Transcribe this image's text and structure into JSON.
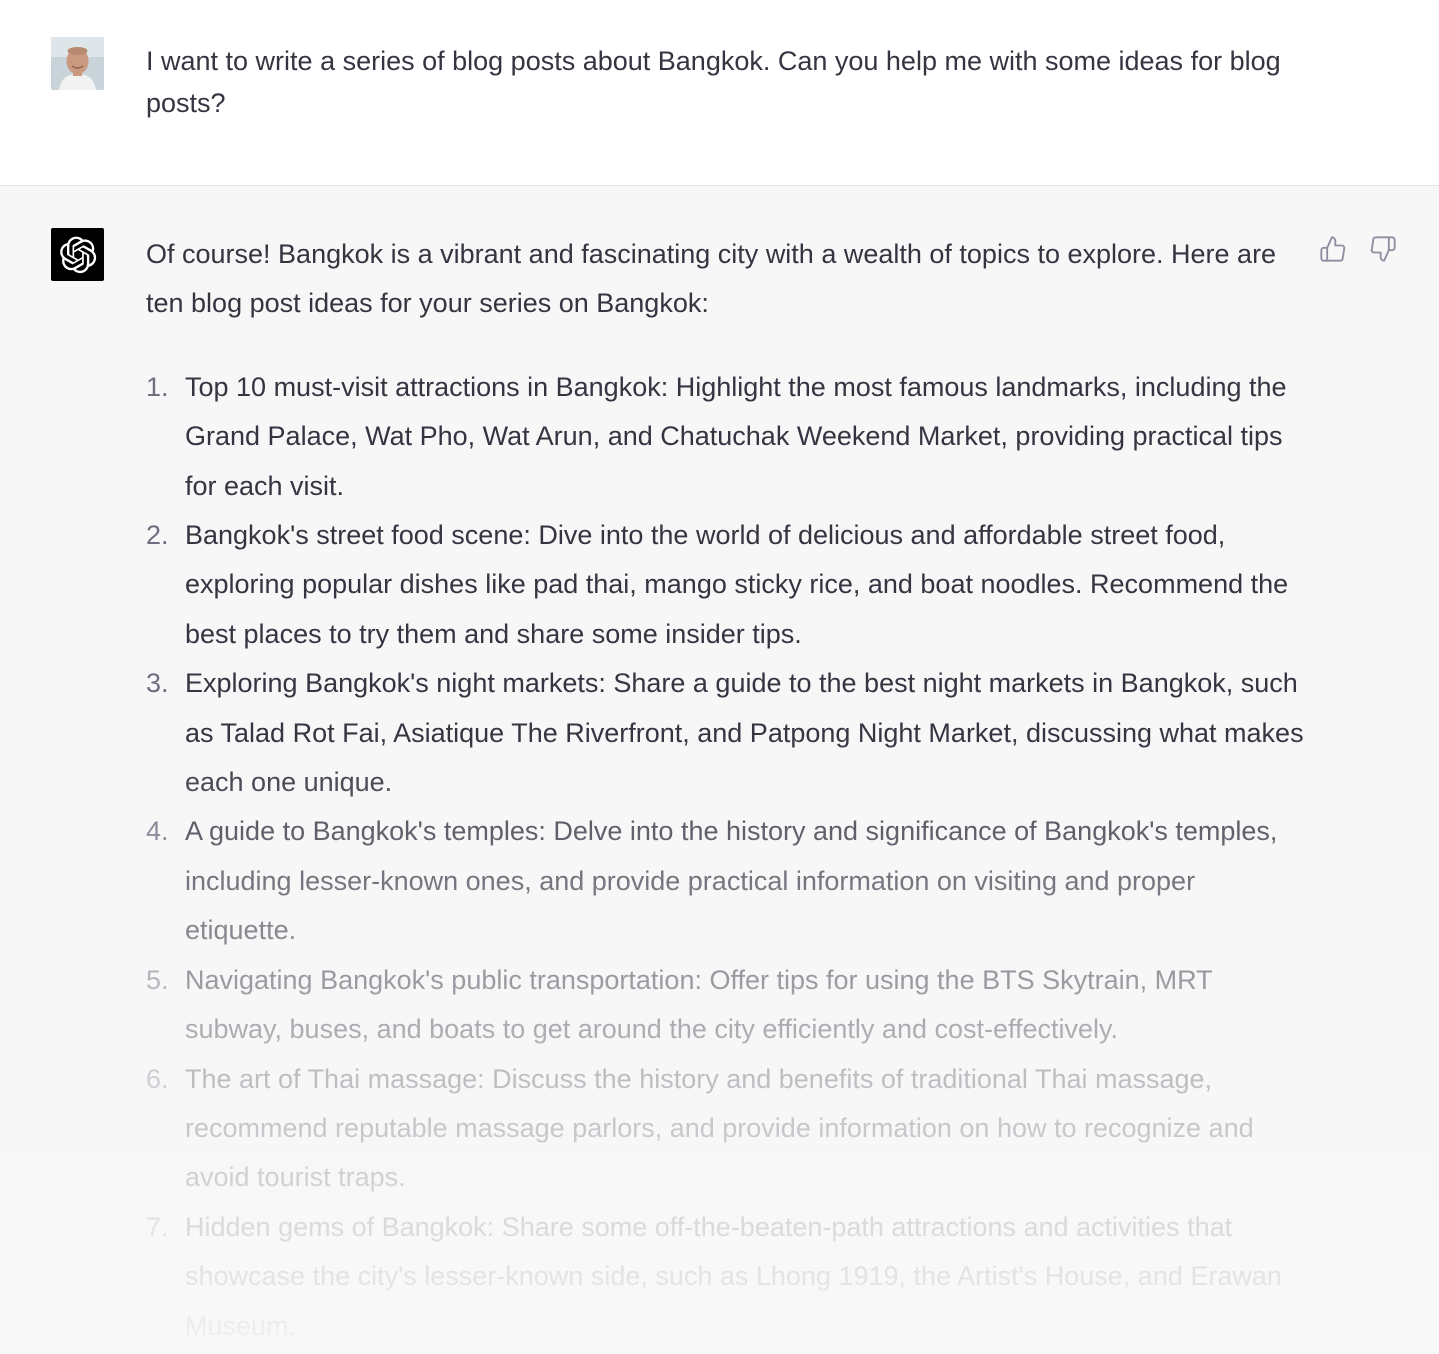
{
  "user_message": {
    "text": "I want to write a series of blog posts about Bangkok. Can you help me with some ideas for blog posts?"
  },
  "assistant_message": {
    "intro": "Of course! Bangkok is a vibrant and fascinating city with a wealth of topics to explore. Here are ten blog post ideas for your series on Bangkok:",
    "ideas": [
      {
        "number": "1.",
        "text": "Top 10 must-visit attractions in Bangkok: Highlight the most famous landmarks, including the Grand Palace, Wat Pho, Wat Arun, and Chatuchak Weekend Market, providing practical tips for each visit."
      },
      {
        "number": "2.",
        "text": "Bangkok's street food scene: Dive into the world of delicious and affordable street food, exploring popular dishes like pad thai, mango sticky rice, and boat noodles. Recommend the best places to try them and share some insider tips."
      },
      {
        "number": "3.",
        "text": "Exploring Bangkok's night markets: Share a guide to the best night markets in Bangkok, such as Talad Rot Fai, Asiatique The Riverfront, and Patpong Night Market, discussing what makes each one unique."
      },
      {
        "number": "4.",
        "text": "A guide to Bangkok's temples: Delve into the history and significance of Bangkok's temples, including lesser-known ones, and provide practical information on visiting and proper etiquette."
      },
      {
        "number": "5.",
        "text": "Navigating Bangkok's public transportation: Offer tips for using the BTS Skytrain, MRT subway, buses, and boats to get around the city efficiently and cost-effectively."
      },
      {
        "number": "6.",
        "text": "The art of Thai massage: Discuss the history and benefits of traditional Thai massage, recommend reputable massage parlors, and provide information on how to recognize and avoid tourist traps."
      },
      {
        "number": "7.",
        "text": "Hidden gems of Bangkok: Share some off-the-beaten-path attractions and activities that showcase the city's lesser-known side, such as Lhong 1919, the Artist's House, and Erawan Museum."
      }
    ]
  },
  "icons": {
    "user_avatar": "user-avatar",
    "assistant_avatar": "openai-logo-icon",
    "thumbs_up": "thumbs-up-icon",
    "thumbs_down": "thumbs-down-icon"
  },
  "colors": {
    "text": "#343541",
    "assistant_bg": "#f7f7f8",
    "user_bg": "#ffffff",
    "icon_gray": "#8e8ea0"
  }
}
